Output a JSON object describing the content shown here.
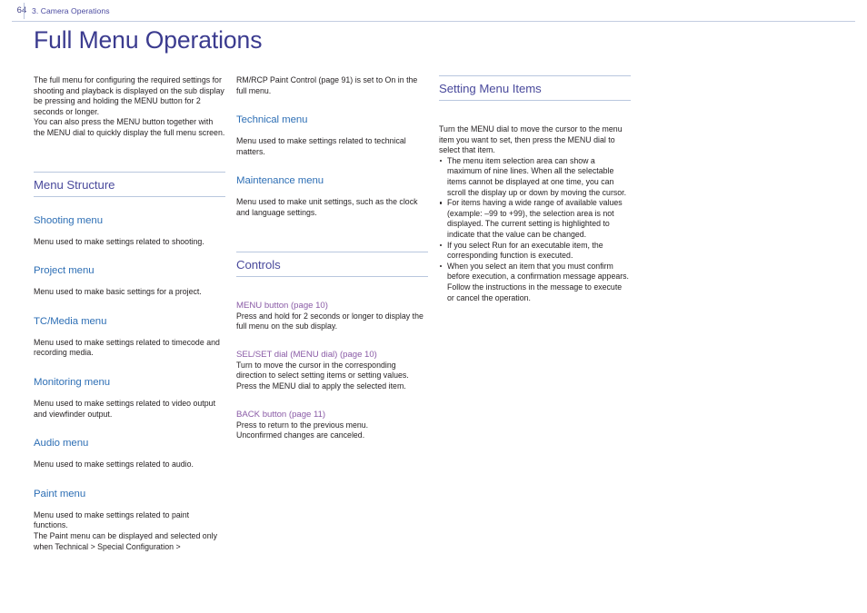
{
  "header": {
    "folio": "64",
    "chapter": "3. Camera Operations"
  },
  "title": "Full Menu Operations",
  "columns": {
    "col1": {
      "intro": [
        "The full menu for configuring the required settings for shooting and playback is displayed on the sub display be pressing and holding the MENU button for 2 seconds or longer.",
        "You can also press the MENU button together with the MENU dial to quickly display the full menu screen."
      ],
      "section_heading": "Menu Structure",
      "entries": [
        {
          "heading": "Shooting menu",
          "body": [
            "Menu used to make settings related to shooting."
          ]
        },
        {
          "heading": "Project menu",
          "body": [
            "Menu used to make basic settings for a project."
          ]
        },
        {
          "heading": "TC/Media menu",
          "body": [
            "Menu used to make settings related to timecode and recording media."
          ]
        },
        {
          "heading": "Monitoring menu",
          "body": [
            "Menu used to make settings related to video output and viewfinder output."
          ]
        },
        {
          "heading": "Audio menu",
          "body": [
            "Menu used to make settings related to audio."
          ]
        },
        {
          "heading": "Paint menu",
          "body": [
            "Menu used to make settings related to paint functions.",
            "The Paint menu can be displayed and selected only when Technical > Special Configuration >"
          ]
        }
      ]
    },
    "col2": {
      "continuation": "RM/RCP Paint Control (page 91) is set to On in the full menu.",
      "entries": [
        {
          "heading": "Technical menu",
          "body": [
            "Menu used to make settings related to technical matters."
          ]
        },
        {
          "heading": "Maintenance menu",
          "body": [
            "Menu used to make unit settings, such as the clock and language settings."
          ]
        }
      ],
      "section_heading": "Controls",
      "controls": [
        {
          "heading": "MENU button (page 10)",
          "body": [
            "Press and hold for 2 seconds or longer to display the full menu on the sub display."
          ]
        },
        {
          "heading": "SEL/SET dial (MENU dial) (page 10)",
          "body": [
            "Turn to move the cursor in the corresponding direction to select setting items or setting values.",
            "Press the MENU dial to apply the selected item."
          ]
        },
        {
          "heading": "BACK button (page 11)",
          "body": [
            "Press to return to the previous menu.",
            "Unconfirmed changes are canceled."
          ]
        }
      ]
    },
    "col3": {
      "section_heading": "Setting Menu Items",
      "intro": "Turn the MENU dial to move the cursor to the menu item you want to set, then press the MENU dial to select that item.",
      "bullets": [
        "The menu item selection area can show a maximum of nine lines. When all the selectable items cannot be displayed at one time, you can scroll the display up or down by moving the cursor.",
        "For items having a wide range of available values (example: –99 to +99), the selection area is not displayed. The current setting is highlighted to indicate that the value can be changed.",
        "If you select Run for an executable item, the corresponding function is executed.",
        "When you select an item that you must confirm before execution, a confirmation message appears. Follow the instructions in the message to execute or cancel the operation."
      ]
    }
  },
  "colors": {
    "title": "#3b3b8f",
    "section_heading": "#4a4a9c",
    "sub_heading": "#2e6fb5",
    "control_heading": "#8a5ba6",
    "rule": "#b9c7de",
    "body_text": "#231f20"
  }
}
